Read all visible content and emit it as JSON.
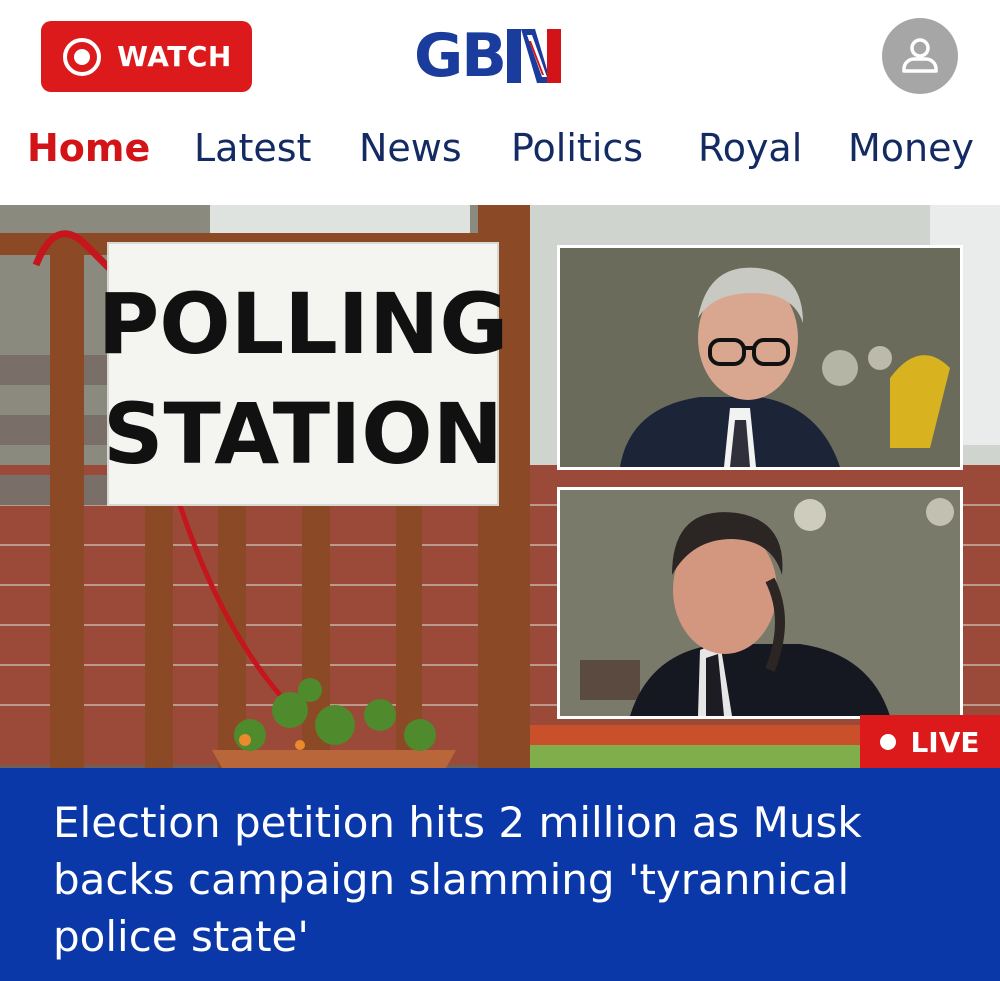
{
  "header": {
    "watch_label": "WATCH",
    "logo_text": "GB",
    "logo_accent": "N",
    "icons": {
      "watch": "record-icon",
      "account": "user-icon"
    }
  },
  "nav": {
    "items": [
      {
        "label": "Home",
        "active": true
      },
      {
        "label": "Latest"
      },
      {
        "label": "News"
      },
      {
        "label": "Politics"
      },
      {
        "label": "Royal"
      },
      {
        "label": "Money"
      }
    ]
  },
  "hero": {
    "sign_line1": "POLLING",
    "sign_line2": "STATION",
    "live_label": "LIVE",
    "headline": "Election petition hits 2 million as Musk backs campaign slamming 'tyrannical police state'"
  },
  "colors": {
    "brand_red": "#dc1a1c",
    "brand_blue": "#0a38a8",
    "nav_text": "#132a63",
    "nav_active": "#d21317"
  }
}
